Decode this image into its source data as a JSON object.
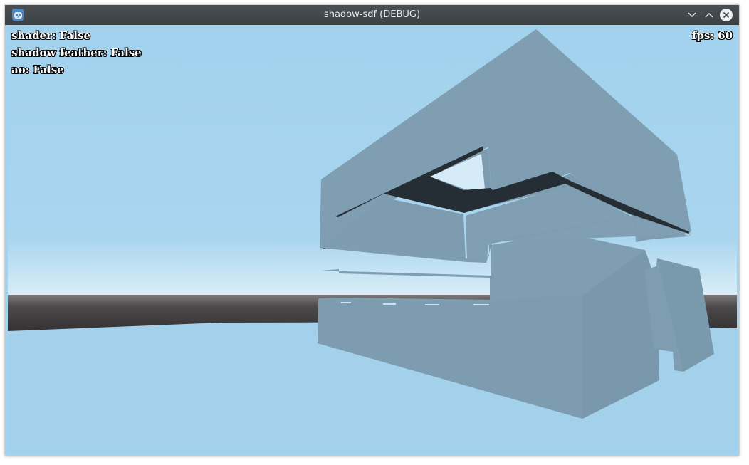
{
  "window": {
    "title": "shadow-sdf (DEBUG)",
    "buttons": {
      "minimize": "chevron-down-icon",
      "maximize": "chevron-up-icon",
      "close": "close-icon"
    }
  },
  "hud": {
    "shader": "shader: False",
    "shadow_feather": "shadow feather: False",
    "ao": "ao: False",
    "fps": "fps: 60"
  },
  "colors": {
    "sky_top": "#a2d2ee",
    "sky_horizon": "#d6ebf6",
    "floor": "#a3d1ec",
    "horizon_band_dark": "#3c3a3a",
    "box": "#7f9eb1",
    "box_dark": "#7a98ab",
    "shadow": "#262e35"
  }
}
